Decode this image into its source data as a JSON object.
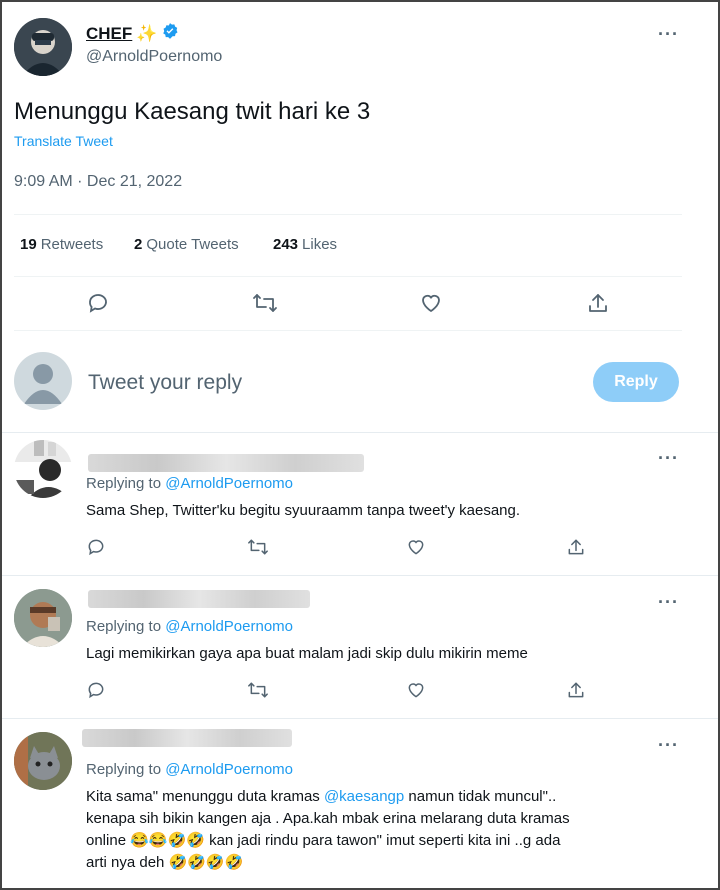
{
  "main_tweet": {
    "author_name": "CHEF",
    "name_emoji": "✨",
    "handle": "@ArnoldPoernomo",
    "text": "Menunggu Kaesang twit hari ke 3",
    "translate_label": "Translate Tweet",
    "timestamp": "9:09 AM · Dec 21, 2022",
    "stats": [
      {
        "count": "19",
        "label": "Retweets"
      },
      {
        "count": "2",
        "label": "Quote Tweets"
      },
      {
        "count": "243",
        "label": "Likes"
      }
    ],
    "more_label": "···"
  },
  "composer": {
    "placeholder": "Tweet your reply",
    "button_label": "Reply"
  },
  "replies": [
    {
      "replying_prefix": "Replying to",
      "replying_to": "@ArnoldPoernomo",
      "text": "Sama Shep, Twitter'ku begitu syuuraamm tanpa tweet'y kaesang."
    },
    {
      "replying_prefix": "Replying to",
      "replying_to": "@ArnoldPoernomo",
      "text": "Lagi memikirkan gaya apa buat malam jadi skip dulu mikirin meme"
    },
    {
      "replying_prefix": "Replying to",
      "replying_to": "@ArnoldPoernomo",
      "text_part1": "Kita sama\" menunggu duta kramas ",
      "mention": "@kaesangp",
      "text_part2": " namun tidak muncul\"..",
      "line2": "kenapa sih bikin kangen aja .   Apa.kah mbak erina melarang duta kramas",
      "line3": "online 😂😂🤣🤣 kan jadi rindu para tawon\" imut seperti kita ini ..g ada",
      "line4": "arti nya deh 🤣🤣🤣🤣"
    }
  ],
  "colors": {
    "accent": "#1d9bf0",
    "secondary_text": "#536471",
    "reply_button_disabled": "#8ecdf8"
  }
}
